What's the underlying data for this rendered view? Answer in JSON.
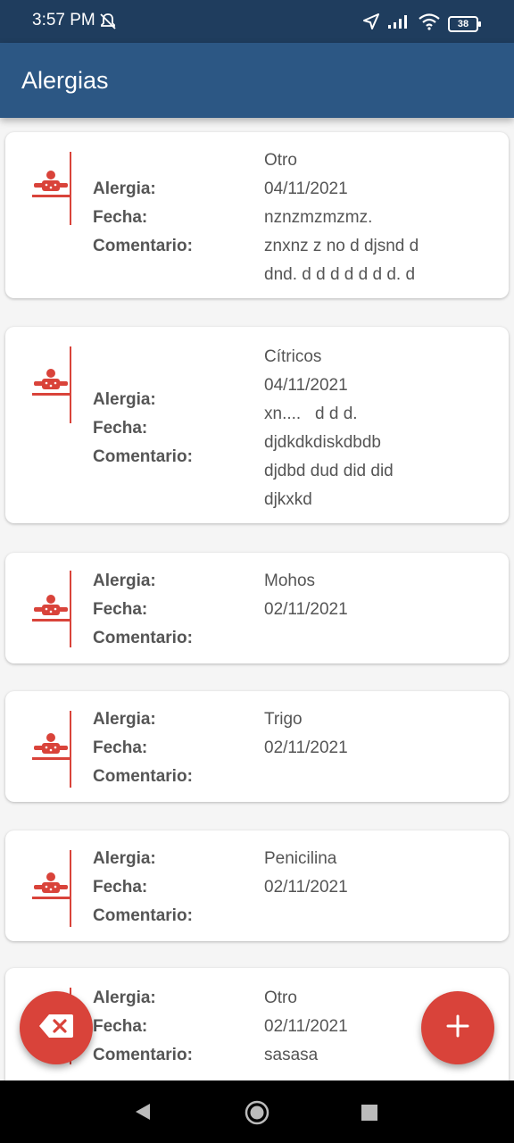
{
  "status_bar": {
    "time": "3:57 PM",
    "battery": "38"
  },
  "app_bar": {
    "title": "Alergias"
  },
  "labels": {
    "allergy": "Alergia:",
    "date": "Fecha:",
    "comment": "Comentario:"
  },
  "allergies": [
    {
      "allergy": "Otro",
      "date": "04/11/2021",
      "comment_lines": [
        "nznzmzmzmz.",
        "znxnz z no d djsnd d",
        "dnd. d d d d d d d. d"
      ]
    },
    {
      "allergy": "Cítricos",
      "date": "04/11/2021",
      "comment_lines": [
        "xn....   d d d.",
        "djdkdkdiskdbdb",
        "djdbd dud did did",
        "djkxkd"
      ]
    },
    {
      "allergy": "Mohos",
      "date": "02/11/2021",
      "comment_lines": []
    },
    {
      "allergy": "Trigo",
      "date": "02/11/2021",
      "comment_lines": []
    },
    {
      "allergy": "Penicilina",
      "date": "02/11/2021",
      "comment_lines": []
    },
    {
      "allergy": "Otro",
      "date": "02/11/2021",
      "comment_lines": [
        "sasasa"
      ]
    }
  ],
  "icons": {
    "allergy_icon": "allergy-person-icon",
    "delete_fab": "backspace-icon",
    "add_fab": "plus-icon"
  },
  "colors": {
    "app_bar": "#2c5784",
    "status_bar": "#1f3d5e",
    "accent": "#d9433a"
  }
}
